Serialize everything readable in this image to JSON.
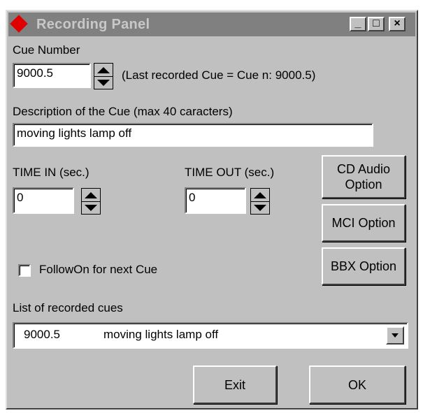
{
  "window": {
    "title": "Recording Panel",
    "controls": {
      "minimize": "_",
      "maximize": "□",
      "close": "×"
    }
  },
  "cue_number": {
    "label": "Cue Number",
    "value": "9000.5",
    "last_recorded_text": "(Last recorded Cue = Cue n:  9000.5)"
  },
  "description": {
    "label": "Description of the Cue (max 40 caracters)",
    "value": "moving lights lamp off"
  },
  "time_in": {
    "label": "TIME IN (sec.)",
    "value": "0"
  },
  "time_out": {
    "label": "TIME OUT (sec.)",
    "value": "0"
  },
  "options": {
    "cd_audio_line1": "CD Audio",
    "cd_audio_line2": "Option",
    "mci": "MCI Option",
    "bbx": "BBX Option"
  },
  "followon": {
    "label": "FollowOn for next Cue",
    "checked": false
  },
  "recorded_list": {
    "label": "List of recorded cues",
    "selected_cue": "9000.5",
    "selected_description": "moving lights lamp off"
  },
  "buttons": {
    "exit": "Exit",
    "ok": "OK"
  },
  "colors": {
    "face": "#c0c0c0",
    "titlebar_inactive": "#808080",
    "icon_red": "#e00000"
  }
}
